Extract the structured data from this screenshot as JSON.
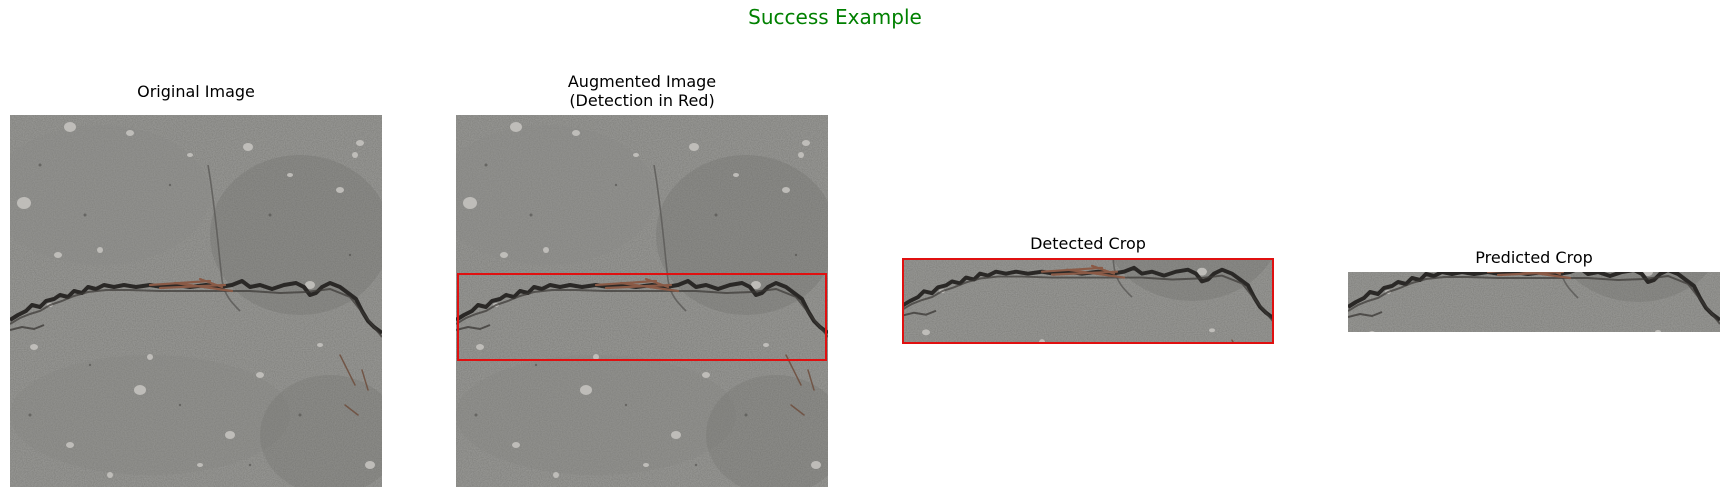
{
  "figure": {
    "title": "Success Example",
    "title_color": "#008000",
    "box_color": "#e01010"
  },
  "panels": [
    {
      "title": "Original Image"
    },
    {
      "title": "Augmented Image\n(Detection in Red)"
    },
    {
      "title": "Detected Crop"
    },
    {
      "title": "Predicted Crop"
    }
  ],
  "texture": {
    "concrete_base": "#7c7c78",
    "crack": "#2a2826",
    "debris": "#8a5a46",
    "pebble": "#c8c6c2"
  }
}
